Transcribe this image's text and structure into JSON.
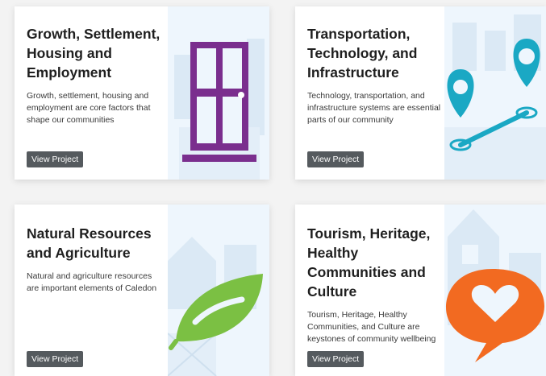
{
  "cards": [
    {
      "title": "Growth, Settlement, Housing and Employment",
      "description": "Growth, settlement, housing and employment are core factors that shape our communities",
      "button": "View Project",
      "icon": "door-icon",
      "icon_color": "#7a2e8e"
    },
    {
      "title": "Transportation, Technology, and Infrastructure",
      "description": "Technology, transportation, and infrastructure systems are essential parts of our community",
      "button": "View Project",
      "icon": "map-route-pins-icon",
      "icon_color": "#1aa8c4"
    },
    {
      "title": "Natural Resources and Agriculture",
      "description": "Natural and agriculture resources are important elements of Caledon",
      "button": "View Project",
      "icon": "leaf-icon",
      "icon_color": "#7bc043"
    },
    {
      "title": "Tourism, Heritage, Healthy Communities and Culture",
      "description": "Tourism, Heritage, Healthy Communities, and Culture are keystones of community wellbeing",
      "button": "View Project",
      "icon": "heart-speech-bubble-icon",
      "icon_color": "#f26a21"
    }
  ],
  "colors": {
    "page_background": "#f3f3f3",
    "card_background": "#ffffff",
    "button_background": "#555a5e",
    "art_background": "#eef6fd"
  }
}
